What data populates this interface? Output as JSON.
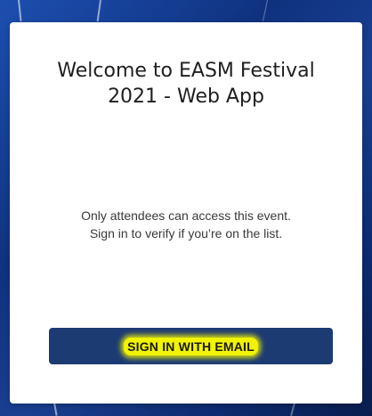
{
  "dialog": {
    "title": "Welcome to EASM Festival 2021 - Web App",
    "message_line1": "Only attendees can access this event.",
    "message_line2": "Sign in to verify if you’re on the list.",
    "signin_button_label": "SIGN IN WITH EMAIL"
  },
  "colors": {
    "background": "#0f327f",
    "card": "#ffffff",
    "button": "#1d3b73",
    "highlight": "#f1f300"
  }
}
